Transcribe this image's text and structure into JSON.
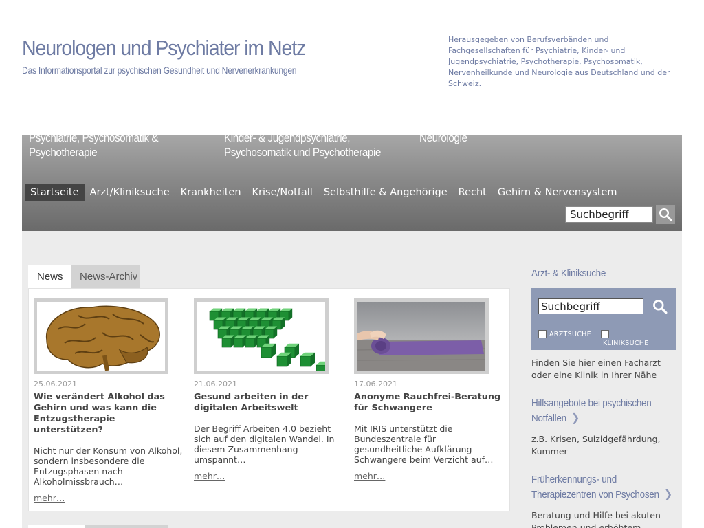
{
  "header": {
    "site_title": "Neurologen und Psychiater im Netz",
    "site_subtitle": "Das Informationsportal zur psychischen Gesundheit und Nervenerkrankungen",
    "publisher_text": "Herausgegeben von Berufsverbänden und Fachgesellschaften für Psychiatrie, Kinder- und Jugendpsychiatrie, Psychotherapie, Psychosomatik, Nervenheilkunde und Neurologie aus Deutschland und der Schweiz."
  },
  "portals": [
    {
      "line1": "Psychiatrie, Psychosomatik &",
      "line2": "Psychotherapie"
    },
    {
      "line1": "Kinder- & Jugendpsychiatrie,",
      "line2": "Psychosomatik und Psychotherapie"
    },
    {
      "line1": "Neurologie",
      "line2": ""
    }
  ],
  "nav": {
    "items": [
      "Startseite",
      "Arzt/Kliniksuche",
      "Krankheiten",
      "Krise/Notfall",
      "Selbsthilfe & Angehörige",
      "Recht",
      "Gehirn & Nervensystem"
    ],
    "active_index": 0
  },
  "search_top": {
    "value": "Suchbegriff",
    "icon": "search-icon"
  },
  "tabs": {
    "news": "News",
    "archive": "News-Archiv"
  },
  "news": [
    {
      "date": "25.06.2021",
      "headline": "Wie verändert Alkohol das Gehirn und was kann die Entzugstherapie unterstützen?",
      "teaser": "Nicht nur der Konsum von Alkohol, sondern insbesondere die Entzugsphasen nach Alkoholmissbrauch…",
      "more": "mehr…",
      "image": "brain-illustration"
    },
    {
      "date": "21.06.2021",
      "headline": "Gesund arbeiten in der digitalen Arbeitswelt",
      "teaser": "Der Begriff Arbeiten 4.0 bezieht sich auf den digitalen Wandel. In diesem Zusammenhang umspannt…",
      "more": "mehr…",
      "image": "green-cubes-illustration"
    },
    {
      "date": "17.06.2021",
      "headline": "Anonyme Rauchfrei-Beratung für Schwangere",
      "teaser": "Mit IRIS unterstützt die Bundeszentrale für gesundheitliche Aufklärung Schwangere beim Verzicht auf…",
      "more": "mehr…",
      "image": "yoga-mat-photo"
    }
  ],
  "sidebar": {
    "search_heading": "Arzt- & Kliniksuche",
    "search_value": "Suchbegriff",
    "checkbox_doctor": "ARZTSUCHE",
    "checkbox_clinic": "KLINIKSUCHE",
    "search_text": "Finden Sie hier einen Facharzt oder eine Klinik in Ihrer Nähe",
    "emergency_heading_1": "Hilfsangebote bei psychischen",
    "emergency_heading_2": "Notfällen",
    "emergency_text": "z.B. Krisen, Suizidgefährdung, Kummer",
    "psychosis_heading": "Früherkennungs- und Therapiezentren von Psychosen",
    "psychosis_text": "Beratung und Hilfe bei akuten Problemen und erhöhtem",
    "chevron": "❯"
  },
  "colors": {
    "brand_text": "#6e7ba3",
    "header_band_top": "#a7a7a7",
    "header_band_bottom": "#6a6a6a",
    "nav_active": "#444444",
    "sidebar_search_bg": "#8e9ab5",
    "content_bg": "#ececec"
  }
}
